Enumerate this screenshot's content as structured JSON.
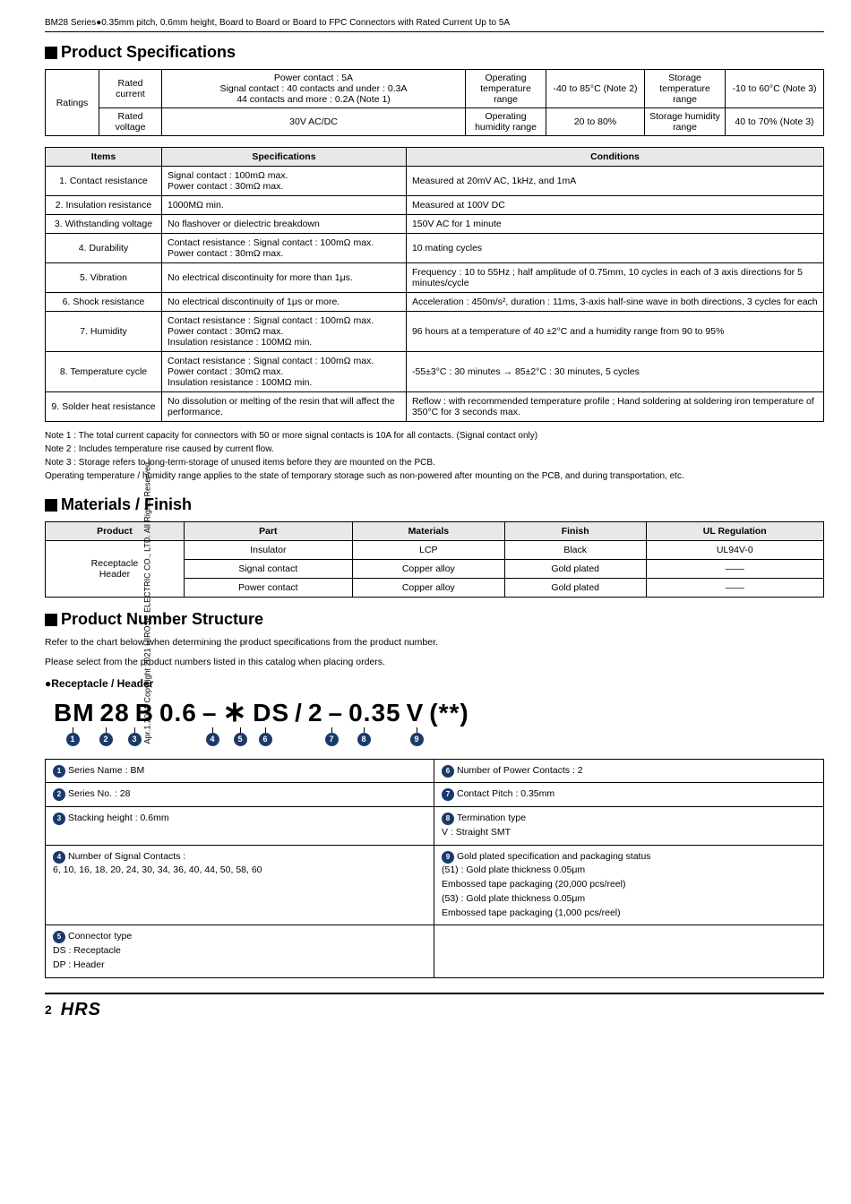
{
  "header": {
    "title": "BM28 Series●0.35mm pitch, 0.6mm height, Board to Board or Board to FPC Connectors with Rated Current Up to 5A"
  },
  "side_text": "Apr.1.2021 Copyright 2021 HIROSE ELECTRIC CO., LTD. All Rights Reserved.",
  "product_specs": {
    "title": "Product Specifications",
    "ratings": {
      "col1": "Ratings",
      "rated_current": "Rated current",
      "power_contact": "Power contact : 5A",
      "signal_contact": "Signal contact : 40 contacts and under : 0.3A",
      "signal_contact2": "44 contacts and more : 0.2A (Note 1)",
      "op_temp_range": "Operating temperature range",
      "op_temp_val": "-40 to 85°C (Note 2)",
      "storage_temp_range": "Storage temperature range",
      "storage_temp_val": "-10 to 60°C (Note 3)",
      "rated_voltage": "Rated voltage",
      "voltage_val": "30V AC/DC",
      "op_humid_range": "Operating humidity range",
      "op_humid_val": "20 to 80%",
      "storage_humid_range": "Storage humidity range",
      "storage_humid_val": "40 to 70% (Note 3)"
    },
    "specs_headers": [
      "Items",
      "Specifications",
      "Conditions"
    ],
    "specs_rows": [
      {
        "item": "1. Contact resistance",
        "spec": "Signal contact : 100mΩ max.\nPower contact : 30mΩ max.",
        "cond": "Measured at 20mV AC, 1kHz, and 1mA"
      },
      {
        "item": "2. Insulation resistance",
        "spec": "1000MΩ min.",
        "cond": "Measured at 100V DC"
      },
      {
        "item": "3. Withstanding voltage",
        "spec": "No flashover or dielectric breakdown",
        "cond": "150V AC for 1 minute"
      },
      {
        "item": "4. Durability",
        "spec": "Contact resistance : Signal contact : 100mΩ max.\nPower contact : 30mΩ max.",
        "cond": "10 mating cycles"
      },
      {
        "item": "5. Vibration",
        "spec": "No electrical discontinuity for more than 1μs.",
        "cond": "Frequency : 10 to 55Hz ; half amplitude of 0.75mm, 10 cycles in each of 3 axis directions for 5 minutes/cycle"
      },
      {
        "item": "6. Shock resistance",
        "spec": "No electrical discontinuity of 1μs or more.",
        "cond": "Acceleration : 450m/s², duration : 11ms, 3-axis half-sine wave in both directions, 3 cycles for each"
      },
      {
        "item": "7. Humidity",
        "spec": "Contact resistance : Signal contact : 100mΩ max.\nPower contact : 30mΩ max.\nInsulation resistance : 100MΩ min.",
        "cond": "96 hours at a temperature of 40 ±2°C and a humidity range from 90 to 95%"
      },
      {
        "item": "8. Temperature cycle",
        "spec": "Contact resistance : Signal contact : 100mΩ max.\nPower contact : 30mΩ max.\nInsulation resistance : 100MΩ min.",
        "cond": "-55±3°C : 30 minutes → 85±2°C : 30 minutes, 5 cycles"
      },
      {
        "item": "9. Solder heat resistance",
        "spec": "No dissolution or melting of the resin that will affect the performance.",
        "cond": "Reflow : with recommended temperature profile ; Hand soldering at soldering iron temperature of 350°C for 3 seconds max."
      }
    ],
    "notes": [
      "Note 1 : The total current capacity for connectors with 50 or more signal contacts is 10A for all contacts. (Signal contact only)",
      "Note 2 : Includes temperature rise caused by current flow.",
      "Note 3 : Storage refers to long-term-storage of unused items before they are mounted on the PCB.",
      "         Operating temperature / humidity range applies to the state of temporary storage such as non-powered after mounting on the PCB, and during transportation, etc."
    ]
  },
  "materials_finish": {
    "title": "Materials / Finish",
    "headers": [
      "Product",
      "Part",
      "Materials",
      "Finish",
      "UL Regulation"
    ],
    "rows": [
      {
        "product": "Receptacle\nHeader",
        "parts": [
          {
            "part": "Insulator",
            "material": "LCP",
            "finish": "Black",
            "ul": "UL94V-0"
          },
          {
            "part": "Signal contact",
            "material": "Copper alloy",
            "finish": "Gold plated",
            "ul": "——"
          },
          {
            "part": "Power contact",
            "material": "Copper alloy",
            "finish": "Gold plated",
            "ul": "——"
          }
        ]
      }
    ]
  },
  "product_number": {
    "title": "Product Number Structure",
    "intro1": "Refer to the chart below when determining the product specifications from the product number.",
    "intro2": "Please select from the product numbers listed in this catalog when placing orders.",
    "bullet_header": "●Receptacle / Header",
    "pn_display": "BM 28 B 0.6 – * DS / 2 – 0.35 V (**)",
    "pn_segments": [
      "BM",
      "28",
      "B",
      "0.6",
      "–",
      "*",
      "DS",
      "/",
      "2",
      "–",
      "0.35",
      "V",
      "(**)"
    ],
    "segment_numbers": [
      "①",
      "②",
      "③",
      "",
      "",
      "④",
      "⑤",
      "⑥",
      "",
      "⑦",
      "⑧",
      "",
      "⑨"
    ],
    "descriptions_left": [
      {
        "num": "①",
        "text": "Series Name : BM"
      },
      {
        "num": "②",
        "text": "Series No. : 28"
      },
      {
        "num": "③",
        "text": "Stacking height : 0.6mm"
      },
      {
        "num": "④",
        "text": "Number of Signal Contacts :\n6, 10, 16, 18, 20, 24, 30, 34, 36, 40, 44, 50, 58, 60"
      },
      {
        "num": "⑤",
        "text": "Connector type\nDS : Receptacle\nDP : Header"
      }
    ],
    "descriptions_right": [
      {
        "num": "⑥",
        "text": "Number of Power Contacts : 2"
      },
      {
        "num": "⑦",
        "text": "Contact Pitch : 0.35mm"
      },
      {
        "num": "⑧",
        "text": "Termination type\nV : Straight SMT"
      },
      {
        "num": "⑨",
        "text": "Gold plated specification and packaging status\n(51) : Gold plate thickness 0.05μm\nEmbossed tape packaging (20,000 pcs/reel)\n(53) : Gold plate thickness 0.05μm\nEmbossed tape packaging (1,000 pcs/reel)"
      }
    ]
  },
  "footer": {
    "page": "2"
  }
}
